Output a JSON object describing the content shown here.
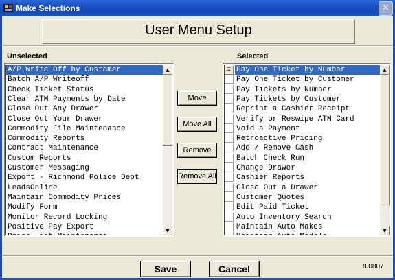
{
  "window": {
    "title": "Make Selections",
    "close_glyph": "✕"
  },
  "header": {
    "title": "User Menu Setup"
  },
  "unselected": {
    "label": "Unselected",
    "items": [
      "A/P Write Off by Customer",
      "Batch A/P Writeoff",
      "Check Ticket Status",
      "Clear ATM Payments by Date",
      "Close Out Any Drawer",
      "Close Out Your Drawer",
      "Commodity File Maintenance",
      "Commodity Reports",
      "Contract Maintenance",
      "Custom Reports",
      "Customer Messaging",
      "Export - Richmond Police Dept",
      "LeadsOnline",
      "Maintain Commodity Prices",
      "Modify Form",
      "Monitor Record Locking",
      "Positive Pay Export",
      "Price List Maintenance"
    ],
    "selected_index": 0
  },
  "selected": {
    "label": "Selected",
    "items": [
      "Pay One Ticket by Number",
      "Pay One Ticket by Customer",
      "Pay Tickets by Number",
      "Pay Tickets by Customer",
      "Reprint a Cashier Receipt",
      "Verify or Reswipe ATM Card",
      "Void a Payment",
      "Retroactive Pricing",
      "Add / Remove Cash",
      "Batch Check Run",
      "Change Drawer",
      "Cashier Reports",
      "Close Out a Drawer",
      "Customer Quotes",
      "Edit Paid Ticket",
      "Auto Inventory Search",
      "Maintain Auto Makes",
      "Maintain Auto Models"
    ],
    "selected_index": 0,
    "sort_glyph": "↕"
  },
  "buttons": {
    "move": "Move",
    "move_all": "Move All",
    "remove": "Remove",
    "remove_all": "Remove All",
    "save": "Save",
    "cancel": "Cancel"
  },
  "scroll_glyphs": {
    "up": "▲",
    "down": "▼"
  },
  "version": "8.0807",
  "colors": {
    "titlebar": "#1a4fc4",
    "selection": "#316ac5",
    "face": "#ece9d8"
  }
}
